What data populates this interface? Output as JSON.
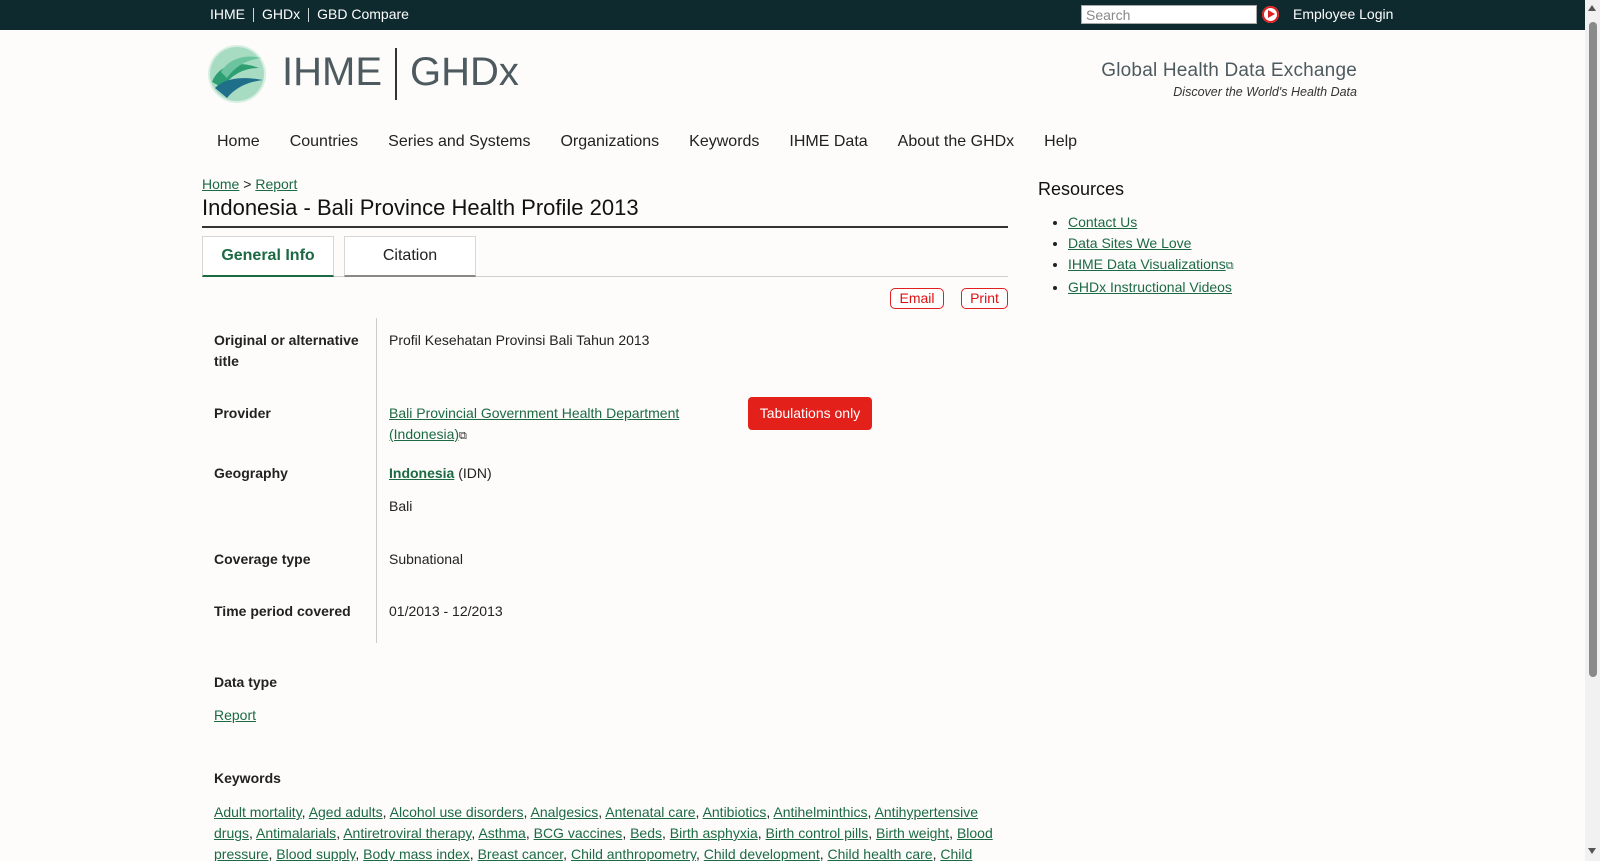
{
  "topbar": {
    "links": [
      "IHME",
      "GHDx",
      "GBD Compare"
    ],
    "search_placeholder": "Search",
    "employee_login": "Employee Login"
  },
  "header": {
    "logo_ihme": "IHME",
    "logo_ghdx": "GHDx",
    "tagline": "Global Health Data Exchange",
    "subtagline": "Discover the World's Health Data"
  },
  "nav": [
    "Home",
    "Countries",
    "Series and Systems",
    "Organizations",
    "Keywords",
    "IHME Data",
    "About the GHDx",
    "Help"
  ],
  "breadcrumb": {
    "home": "Home",
    "sep": ">",
    "report": "Report"
  },
  "page_title": "Indonesia - Bali Province Health Profile 2013",
  "tabs": {
    "general": "General Info",
    "citation": "Citation"
  },
  "actions": {
    "email": "Email",
    "print": "Print"
  },
  "info": {
    "alt_title_label": "Original or alternative title",
    "alt_title_value": "Profil Kesehatan Provinsi Bali Tahun 2013",
    "provider_label": "Provider",
    "provider_value": "Bali Provincial Government Health Department (Indonesia)",
    "badge": "Tabulations only",
    "geography_label": "Geography",
    "geo_country": "Indonesia",
    "geo_code": "(IDN)",
    "geo_sub": "Bali",
    "coverage_label": "Coverage type",
    "coverage_value": "Subnational",
    "time_label": "Time period covered",
    "time_value": "01/2013 - 12/2013",
    "datatype_label": "Data type",
    "datatype_value": "Report",
    "keywords_label": "Keywords"
  },
  "keywords": [
    "Adult mortality",
    "Aged adults",
    "Alcohol use disorders",
    "Analgesics",
    "Antenatal care",
    "Antibiotics",
    "Antihelminthics",
    "Antihypertensive drugs",
    "Antimalarials",
    "Antiretroviral therapy",
    "Asthma",
    "BCG vaccines",
    "Beds",
    "Birth asphyxia",
    "Birth control pills",
    "Birth weight",
    "Blood pressure",
    "Blood supply",
    "Body mass index",
    "Breast cancer",
    "Child anthropometry",
    "Child development",
    "Child health care",
    "Child"
  ],
  "sidebar": {
    "title": "Resources",
    "links": [
      "Contact Us",
      "Data Sites We Love",
      "IHME Data Visualizations",
      "GHDx Instructional Videos"
    ]
  },
  "colors": {
    "topbar": "#0f2a2e",
    "link": "#1c6a43",
    "accent_red": "#e32019"
  }
}
